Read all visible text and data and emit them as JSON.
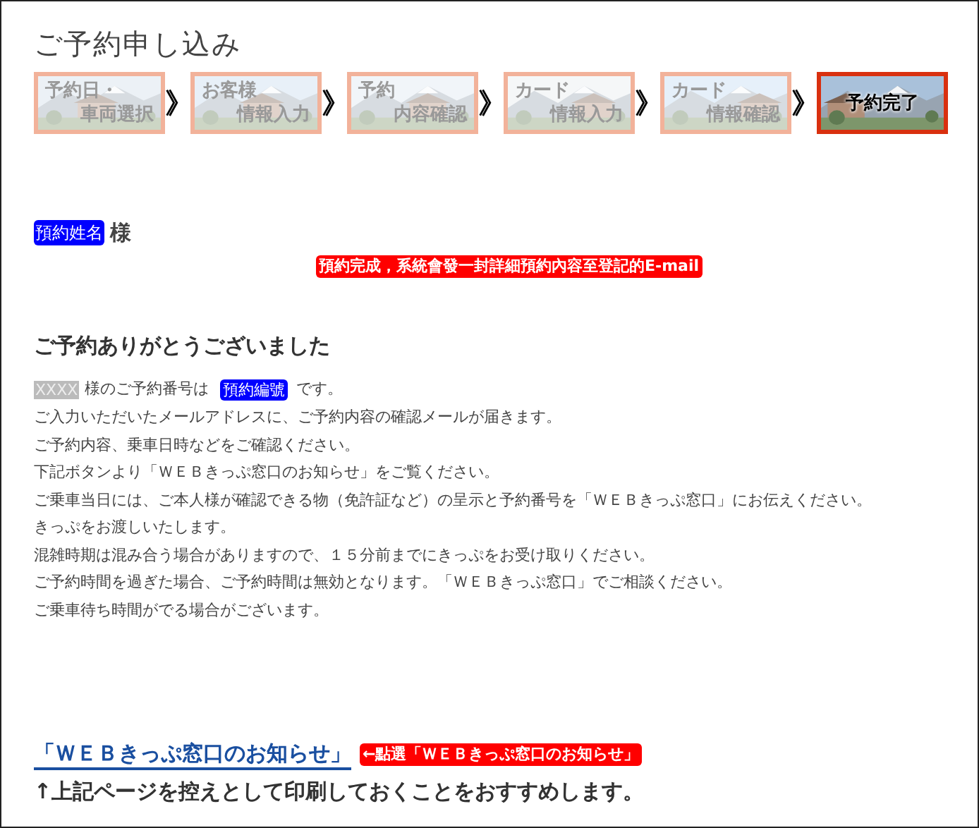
{
  "title": "ご予約申し込み",
  "steps": [
    {
      "lines": [
        "予約日・",
        "車両選択"
      ],
      "selected": false
    },
    {
      "lines": [
        "お客様",
        "情報入力"
      ],
      "selected": false
    },
    {
      "lines": [
        "予約",
        "内容確認"
      ],
      "selected": false
    },
    {
      "lines": [
        "カード",
        "情報入力"
      ],
      "selected": false
    },
    {
      "lines": [
        "カード",
        "情報確認"
      ],
      "selected": false
    },
    {
      "lines": [
        "予約完了"
      ],
      "selected": true
    }
  ],
  "step_separator": "》",
  "customer": {
    "name_tag": "預約姓名",
    "suffix": "様"
  },
  "note_email": "預約完成，系統會發一封詳細預約內容至登記的E-mail",
  "heading": "ご予約ありがとうございました",
  "reservation_line": {
    "masked_name": "XXXX",
    "before": "様のご予約番号は",
    "number_tag": "預約編號",
    "after": "です。"
  },
  "lines": [
    "ご入力いただいたメールアドレスに、ご予約内容の確認メールが届きます。",
    "ご予約内容、乗車日時などをご確認ください。",
    "下記ボタンより「ＷＥＢきっぷ窓口のお知らせ」をご覧ください。",
    "ご乗車当日には、ご本人様が確認できる物（免許証など）の呈示と予約番号を「ＷＥＢきっぷ窓口」にお伝えください。",
    "きっぷをお渡しいたします。",
    "混雑時期は混み合う場合がありますので、１５分前までにきっぷをお受け取りください。",
    "ご予約時間を過ぎた場合、ご予約時間は無効となります。「ＷＥＢきっぷ窓口」でご相談ください。",
    "ご乗車待ち時間がでる場合がございます。"
  ],
  "link": "「ＷＥＢきっぷ窓口のお知らせ」",
  "note_click": "←點選「ＷＥＢきっぷ窓口のお知らせ」",
  "footer": "↑上記ページを控えとして印刷しておくことをおすすめします。"
}
